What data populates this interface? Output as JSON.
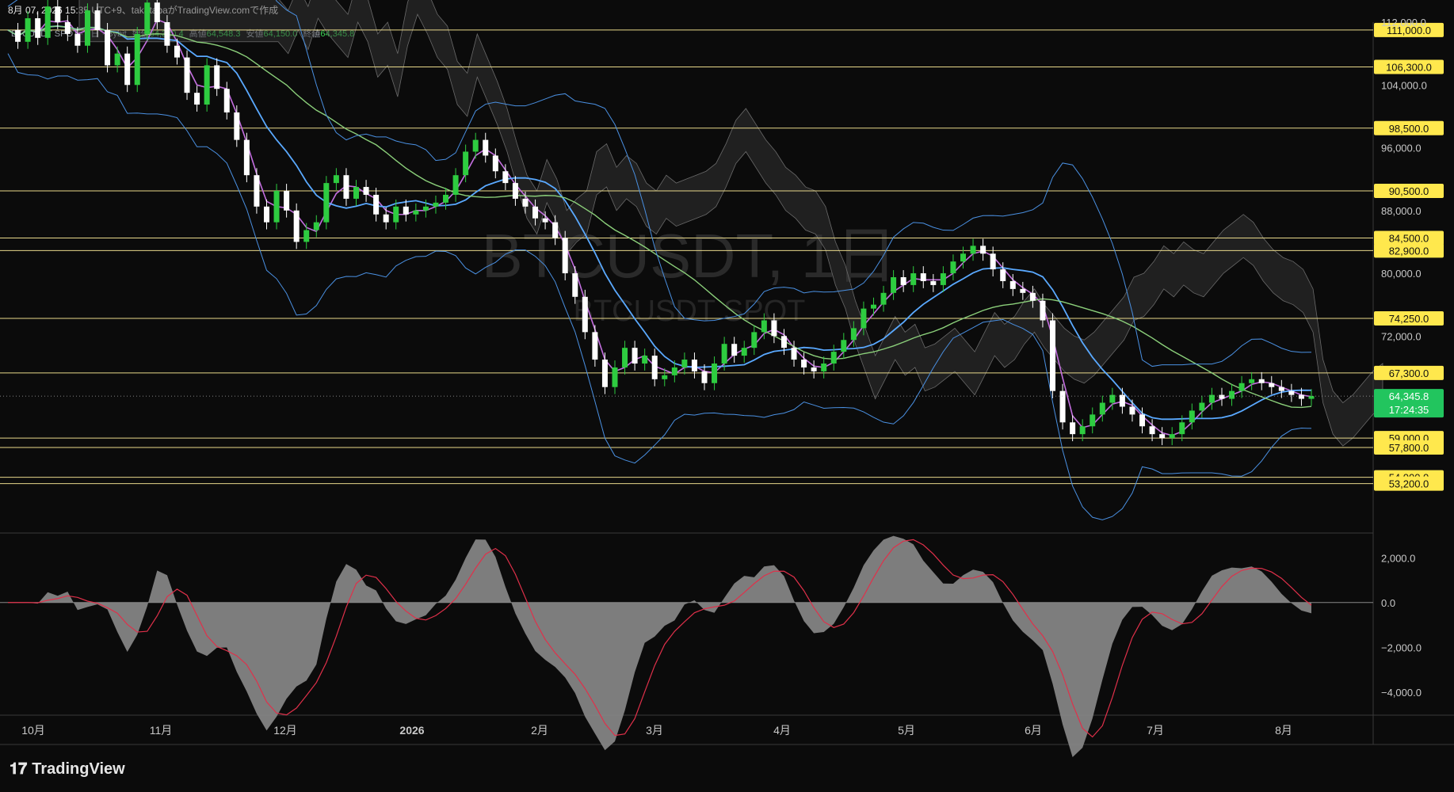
{
  "header": {
    "caption": "8月 07, 2026 15:35 UTC+9、takatabaがTradingView.comで作成"
  },
  "legend": {
    "symbol": "BTCUSDT SPOT · 1日 · Bybit",
    "open_label": "始値",
    "open": "64,320.4",
    "high_label": "高値",
    "high": "64,548.3",
    "low_label": "安値",
    "low": "64,150.0",
    "close_label": "終値",
    "close": "64,345.8"
  },
  "watermark": {
    "main": "BTCUSDT, 1日",
    "sub": "BTCUSDT SPOT"
  },
  "brand": "TradingView",
  "colors": {
    "background": "#0b0b0b",
    "up_candle": "#2ecc40",
    "down_candle": "#ffffff",
    "level_line": "#e8d88a",
    "level_tag": "#ffe84d",
    "bollinger": "#4a90e2",
    "ema_fast": "#c46fe0",
    "ema_slow": "#5aa9ff",
    "sma_long": "#8bcf7a",
    "cloud": "#3a3a3a",
    "macd_hist": "#8a8a8a",
    "macd_signal": "#e0304a",
    "current_price": "#22c55e"
  },
  "chart_data": [
    {
      "type": "candlestick",
      "x_labels": [
        "10月",
        "11月",
        "12月",
        "2026",
        "2月",
        "3月",
        "4月",
        "5月",
        "6月",
        "7月",
        "8月"
      ],
      "y_ticks": [
        "112,000.0",
        "104,000.0",
        "96,000.0",
        "88,000.0",
        "80,000.0",
        "72,000.0"
      ],
      "ylim": [
        47000,
        112000
      ],
      "close_series": [
        111000,
        109500,
        112500,
        110000,
        114000,
        112000,
        110500,
        109000,
        113500,
        111000,
        106500,
        108000,
        104000,
        110500,
        114500,
        112000,
        109000,
        107500,
        103000,
        101500,
        106500,
        103500,
        100500,
        97000,
        92500,
        88500,
        86500,
        90500,
        88000,
        84000,
        85500,
        86500,
        91500,
        92500,
        89500,
        91000,
        90000,
        87500,
        86500,
        88500,
        87500,
        88000,
        88500,
        89000,
        90000,
        92500,
        95500,
        97000,
        95000,
        93000,
        91500,
        89500,
        88500,
        87000,
        86500,
        84500,
        80000,
        77000,
        72500,
        69000,
        65500,
        68000,
        70500,
        68500,
        69500,
        66500,
        67000,
        68000,
        69000,
        67500,
        66000,
        68500,
        71000,
        69500,
        70500,
        72500,
        74000,
        72000,
        70500,
        69000,
        68000,
        67500,
        68500,
        70000,
        71500,
        73000,
        75500,
        76000,
        77500,
        79500,
        78500,
        80000,
        79000,
        78500,
        80000,
        81500,
        82500,
        83500,
        82500,
        80500,
        79000,
        78000,
        77500,
        76500,
        74000,
        65000,
        61000,
        59500,
        60500,
        62000,
        63500,
        64500,
        63000,
        62000,
        60500,
        59500,
        59000,
        59500,
        61000,
        62500,
        63500,
        64500,
        64000,
        65000,
        66000,
        66500,
        66000,
        65500,
        65000,
        64500,
        64000,
        64345
      ],
      "levels": [
        111000,
        106300,
        98500,
        90500,
        84500,
        82900,
        74250,
        67300,
        59000,
        57800,
        54000,
        53200
      ],
      "level_labels": [
        "111,000.0",
        "106,300.0",
        "98,500.0",
        "90,500.0",
        "84,500.0",
        "82,900.0",
        "74,250.0",
        "67,300.0",
        "59,000.0",
        "57,800.0",
        "54,000.0",
        "53,200.0"
      ],
      "current_price": "64,345.8",
      "countdown": "17:24:35"
    },
    {
      "type": "area",
      "name": "MACD",
      "y_ticks": [
        "2,000.0",
        "0.0",
        "−2,000.0",
        "−4,000.0"
      ],
      "ylim": [
        -5000,
        3000
      ]
    }
  ]
}
